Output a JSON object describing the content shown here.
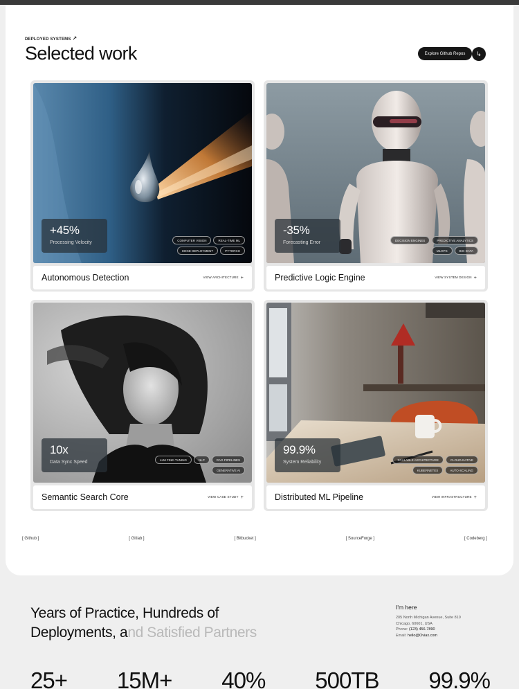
{
  "section": {
    "eyebrow": "DEPLOYED SYSTEMS",
    "eyebrow_icon": "arrow-up-right-icon",
    "title": "Selected work",
    "github_button": "Explore Github Repos",
    "github_icon": "arrow-enter-icon"
  },
  "cards": [
    {
      "metric": "+45%",
      "metric_label": "Processing Velocity",
      "tags": [
        "COMPUTER VISION",
        "REAL-TIME ML",
        "EDGE DEPLOYMENT",
        "PYTORCH"
      ],
      "title": "Autonomous Detection",
      "link": "VIEW ARCHITECTURE"
    },
    {
      "metric": "-35%",
      "metric_label": "Forecasting Error",
      "tags": [
        "DECISION ENGINES",
        "PREDICTIVE ANALYTICS",
        "MLOPS",
        "BIG DATA"
      ],
      "title": "Predictive Logic Engine",
      "link": "VIEW SYSTEM DESIGN"
    },
    {
      "metric": "10x",
      "metric_label": "Data Sync Speed",
      "tags": [
        "LLM FINE-TUNING",
        "NLP",
        "RAG PIPELINES",
        "GENERATIVE AI"
      ],
      "title": "Semantic Search Core",
      "link": "VIEW CASE STUDY"
    },
    {
      "metric": "99.9%",
      "metric_label": "System Reliability",
      "tags": [
        "SCALABLE ARCHITECTURE",
        "CLOUD-NATIVE",
        "KUBERNETES",
        "AUTO-SCALING"
      ],
      "title": "Distributed ML Pipeline",
      "link": "VIEW INFRASTRUCTURE"
    }
  ],
  "repos": [
    "[ Github ]",
    "[ Gitlab ]",
    "[ Bitbucket ]",
    "[ SourceForge ]",
    "[ Codeberg ]"
  ],
  "practice": {
    "line1": "Years of Practice, Hundreds of",
    "line2_dark": "Deployments, a",
    "line2_fade": "nd Satisfied Partners"
  },
  "contact": {
    "heading": "I'm here",
    "address1": "205 North Michigan Avenue, Suite 810",
    "address2": "Chicago, 60601, USA",
    "phone_label": "Phone:",
    "phone": "(123) 456-7890",
    "email_label": "Email:",
    "email": "hello@Oviax.com"
  },
  "stats": [
    "25+",
    "15M+",
    "40%",
    "500TB",
    "99.9%"
  ]
}
